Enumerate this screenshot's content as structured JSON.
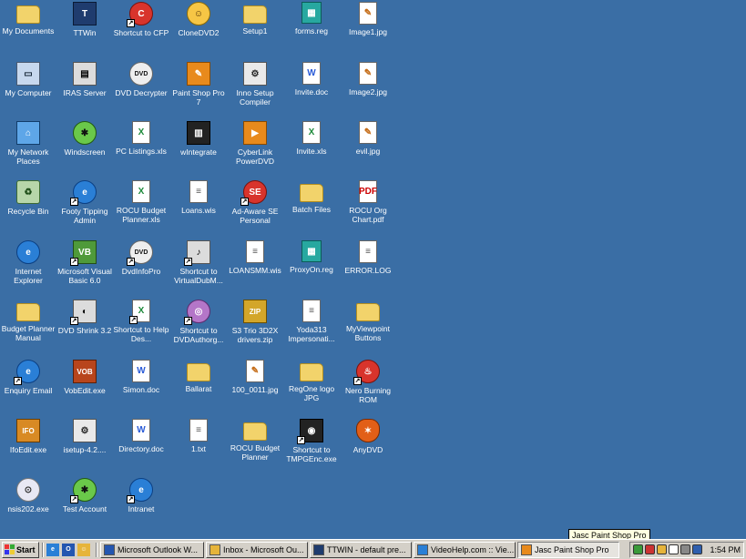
{
  "desktop": {
    "icons": [
      {
        "label": "My Documents",
        "icon": "my-documents-icon",
        "glyph": "g-folder",
        "sym": ""
      },
      {
        "label": "TTWin",
        "icon": "ttwin-icon",
        "glyph": "g-dark",
        "sym": "T"
      },
      {
        "label": "Shortcut to CFP",
        "icon": "cfp-shortcut-icon",
        "glyph": "g-red",
        "sym": "C",
        "shortcut": true
      },
      {
        "label": "CloneDVD2",
        "icon": "clonedvd-icon",
        "glyph": "g-yellow",
        "sym": "☺"
      },
      {
        "label": "Setup1",
        "icon": "folder-icon",
        "glyph": "g-folder",
        "sym": ""
      },
      {
        "label": "forms.reg",
        "icon": "registry-file-icon",
        "glyph": "g-reg",
        "sym": "▦"
      },
      {
        "label": "Image1.jpg",
        "icon": "image-file-icon",
        "glyph": "g-img",
        "sym": "✎"
      },
      {
        "label": "My Computer",
        "icon": "my-computer-icon",
        "glyph": "g-pc",
        "sym": "▭"
      },
      {
        "label": "IRAS Server",
        "icon": "iras-server-icon",
        "glyph": "g-app",
        "sym": "▤"
      },
      {
        "label": "DVD Decrypter",
        "icon": "dvd-decrypter-icon",
        "glyph": "g-dvd",
        "sym": "DVD"
      },
      {
        "label": "Paint Shop Pro 7",
        "icon": "paint-shop-pro-icon",
        "glyph": "g-orange",
        "sym": "✎"
      },
      {
        "label": "Inno Setup Compiler",
        "icon": "inno-setup-icon",
        "glyph": "g-setup",
        "sym": "⚙"
      },
      {
        "label": "Invite.doc",
        "icon": "word-document-icon",
        "glyph": "g-doc",
        "sym": "W"
      },
      {
        "label": "Image2.jpg",
        "icon": "image-file-icon",
        "glyph": "g-img",
        "sym": "✎"
      },
      {
        "label": "My Network Places",
        "icon": "network-places-icon",
        "glyph": "g-net",
        "sym": "⌂"
      },
      {
        "label": "Windscreen",
        "icon": "windscreen-icon",
        "glyph": "g-bug",
        "sym": "✱",
        "shortcut": false
      },
      {
        "label": "PC Listings.xls",
        "icon": "excel-file-icon",
        "glyph": "g-xls",
        "sym": "X"
      },
      {
        "label": "wIntegrate",
        "icon": "wintegrate-icon",
        "glyph": "g-black",
        "sym": "▥"
      },
      {
        "label": "CyberLink PowerDVD",
        "icon": "powerdvd-icon",
        "glyph": "g-orange",
        "sym": "▶"
      },
      {
        "label": "Invite.xls",
        "icon": "excel-file-icon",
        "glyph": "g-xls",
        "sym": "X"
      },
      {
        "label": "evil.jpg",
        "icon": "image-file-icon",
        "glyph": "g-img",
        "sym": "✎"
      },
      {
        "label": "Recycle Bin",
        "icon": "recycle-bin-icon",
        "glyph": "g-bin",
        "sym": "♻"
      },
      {
        "label": "Footy Tipping Admin",
        "icon": "footy-tipping-icon",
        "glyph": "g-globe",
        "sym": "e",
        "shortcut": true
      },
      {
        "label": "ROCU Budget Planner.xls",
        "icon": "excel-file-icon",
        "glyph": "g-xls",
        "sym": "X"
      },
      {
        "label": "Loans.wis",
        "icon": "wis-file-icon",
        "glyph": "g-txt",
        "sym": "≡"
      },
      {
        "label": "Ad-Aware SE Personal",
        "icon": "ad-aware-icon",
        "glyph": "g-red",
        "sym": "SE",
        "shortcut": true
      },
      {
        "label": "Batch Files",
        "icon": "folder-icon",
        "glyph": "g-folder",
        "sym": ""
      },
      {
        "label": "ROCU Org Chart.pdf",
        "icon": "pdf-file-icon",
        "glyph": "g-pdf",
        "sym": "PDF"
      },
      {
        "label": "Internet Explorer",
        "icon": "internet-explorer-icon",
        "glyph": "g-globe",
        "sym": "e"
      },
      {
        "label": "Microsoft Visual Basic 6.0",
        "icon": "visual-basic-icon",
        "glyph": "g-green",
        "sym": "VB",
        "shortcut": true
      },
      {
        "label": "DvdInfoPro",
        "icon": "dvdinfopro-icon",
        "glyph": "g-dvd",
        "sym": "DVD",
        "shortcut": true
      },
      {
        "label": "Shortcut to VirtualDubM...",
        "icon": "virtualdub-shortcut-icon",
        "glyph": "g-app",
        "sym": "♪",
        "shortcut": true
      },
      {
        "label": "LOANSMM.wis",
        "icon": "wis-file-icon",
        "glyph": "g-txt",
        "sym": "≡"
      },
      {
        "label": "ProxyOn.reg",
        "icon": "registry-file-icon",
        "glyph": "g-reg",
        "sym": "▦"
      },
      {
        "label": "ERROR.LOG",
        "icon": "log-file-icon",
        "glyph": "g-txt",
        "sym": "≡"
      },
      {
        "label": "Budget Planner Manual",
        "icon": "folder-icon",
        "glyph": "g-folder",
        "sym": ""
      },
      {
        "label": "DVD Shrink 3.2",
        "icon": "dvd-shrink-icon",
        "glyph": "g-app",
        "sym": "◐",
        "shortcut": true
      },
      {
        "label": "Shortcut to Help Des...",
        "icon": "excel-shortcut-icon",
        "glyph": "g-xls",
        "sym": "X",
        "shortcut": true
      },
      {
        "label": "Shortcut to DVDAuthorg...",
        "icon": "dvdauthor-shortcut-icon",
        "glyph": "g-purple",
        "sym": "◎",
        "shortcut": true
      },
      {
        "label": "S3 Trio 3D2X drivers.zip",
        "icon": "zip-file-icon",
        "glyph": "g-zip",
        "sym": "ZIP"
      },
      {
        "label": "Yoda313 Impersonati...",
        "icon": "text-file-icon",
        "glyph": "g-txt",
        "sym": "≡"
      },
      {
        "label": "MyViewpoint Buttons",
        "icon": "folder-icon",
        "glyph": "g-folder",
        "sym": ""
      },
      {
        "label": "Enquiry Email",
        "icon": "enquiry-email-icon",
        "glyph": "g-globe",
        "sym": "e",
        "shortcut": true
      },
      {
        "label": "VobEdit.exe",
        "icon": "vobedit-icon",
        "glyph": "g-vob",
        "sym": "VOB"
      },
      {
        "label": "Simon.doc",
        "icon": "word-document-icon",
        "glyph": "g-doc",
        "sym": "W"
      },
      {
        "label": "Ballarat",
        "icon": "folder-icon",
        "glyph": "g-folder",
        "sym": ""
      },
      {
        "label": "100_0011.jpg",
        "icon": "image-file-icon",
        "glyph": "g-img",
        "sym": "✎"
      },
      {
        "label": "RegOne logo JPG",
        "icon": "folder-icon",
        "glyph": "g-folder",
        "sym": ""
      },
      {
        "label": "Nero Burning ROM",
        "icon": "nero-icon",
        "glyph": "g-red",
        "sym": "♨",
        "shortcut": true
      },
      {
        "label": "IfoEdit.exe",
        "icon": "ifoedit-icon",
        "glyph": "g-ifo",
        "sym": "IFO"
      },
      {
        "label": "isetup-4.2....",
        "icon": "isetup-icon",
        "glyph": "g-setup",
        "sym": "⚙"
      },
      {
        "label": "Directory.doc",
        "icon": "word-document-icon",
        "glyph": "g-doc",
        "sym": "W"
      },
      {
        "label": "1.txt",
        "icon": "text-file-icon",
        "glyph": "g-txt",
        "sym": "≡"
      },
      {
        "label": "ROCU Budget Planner",
        "icon": "folder-icon",
        "glyph": "g-folder",
        "sym": ""
      },
      {
        "label": "Shortcut to TMPGEnc.exe",
        "icon": "tmpgenc-shortcut-icon",
        "glyph": "g-black",
        "sym": "◉",
        "shortcut": true
      },
      {
        "label": "AnyDVD",
        "icon": "anydvd-icon",
        "glyph": "g-fox",
        "sym": "✶"
      },
      {
        "label": "nsis202.exe",
        "icon": "nsis-installer-icon",
        "glyph": "g-disc",
        "sym": "⊙"
      },
      {
        "label": "Test Account",
        "icon": "test-account-icon",
        "glyph": "g-bug",
        "sym": "✱",
        "shortcut": true
      },
      {
        "label": "Intranet",
        "icon": "intranet-icon",
        "glyph": "g-globe",
        "sym": "e",
        "shortcut": true
      }
    ]
  },
  "tooltip": "Jasc Paint Shop Pro",
  "taskbar": {
    "start_label": "Start",
    "quick_launch": [
      {
        "icon": "internet-explorer-icon",
        "color": "#2a7fd6",
        "sym": "e"
      },
      {
        "icon": "outlook-icon",
        "color": "#2456b0",
        "sym": "O"
      },
      {
        "icon": "clonedvd-icon",
        "color": "#e6b43a",
        "sym": "☺"
      }
    ],
    "tasks": [
      {
        "label": "Microsoft Outlook W...",
        "icon": "outlook-icon",
        "color": "#2456b0"
      },
      {
        "label": "Inbox - Microsoft Ou...",
        "icon": "outlook-inbox-icon",
        "color": "#e6b43a"
      },
      {
        "label": "TTWIN - default pre...",
        "icon": "ttwin-icon",
        "color": "#1f3c6e"
      },
      {
        "label": "VideoHelp.com :: Vie...",
        "icon": "internet-explorer-icon",
        "color": "#2a7fd6"
      },
      {
        "label": "Jasc Paint Shop Pro",
        "icon": "paint-shop-pro-icon",
        "color": "#e88a1c",
        "active": true
      }
    ],
    "tray_icons": [
      {
        "icon": "network-tray-icon",
        "color": "#3a9a3a"
      },
      {
        "icon": "antivirus-tray-icon",
        "color": "#c33"
      },
      {
        "icon": "clonedvd-tray-icon",
        "color": "#e6b43a"
      },
      {
        "icon": "clock-tray-icon",
        "color": "#ffffff"
      },
      {
        "icon": "volume-tray-icon",
        "color": "#888888"
      },
      {
        "icon": "mail-tray-icon",
        "color": "#2f5fae"
      }
    ],
    "clock": "1:54 PM"
  }
}
